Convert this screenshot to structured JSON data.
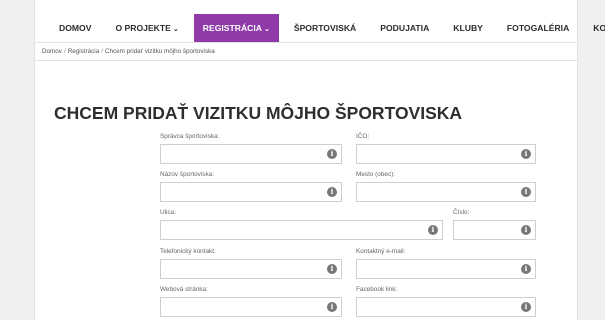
{
  "nav": {
    "items": [
      {
        "label": "DOMOV",
        "caret": ""
      },
      {
        "label": "O PROJEKTE",
        "caret": "⌄"
      },
      {
        "label": "REGISTRÁCIA",
        "caret": "⌄"
      },
      {
        "label": "ŠPORTOVISKÁ",
        "caret": ""
      },
      {
        "label": "PODUJATIA",
        "caret": ""
      },
      {
        "label": "KLUBY",
        "caret": ""
      },
      {
        "label": "FOTOGALÉRIA",
        "caret": ""
      },
      {
        "label": "KONTAKT",
        "caret": ""
      }
    ],
    "active_color": "#8e3aa8"
  },
  "breadcrumb": {
    "items": [
      "Domov",
      "Registrácia",
      "Chcem pridať vizitku môjho športoviska"
    ],
    "separator": "/"
  },
  "page": {
    "title": "CHCEM PRIDAŤ VIZITKU MÔJHO ŠPORTOVISKA"
  },
  "form": {
    "info_glyph": "i",
    "fields": [
      {
        "label": "Správca športoviska:",
        "value": ""
      },
      {
        "label": "IČO:",
        "value": ""
      },
      {
        "label": "Názov športoviska:",
        "value": ""
      },
      {
        "label": "Mesto (obec):",
        "value": ""
      },
      {
        "label": "Ulica:",
        "value": ""
      },
      {
        "label": "Číslo:",
        "value": ""
      },
      {
        "label": "Telefonický kontakt:",
        "value": ""
      },
      {
        "label": "Kontaktný e-mail:",
        "value": ""
      },
      {
        "label": "Webová stránka:",
        "value": ""
      },
      {
        "label": "Facebook link:",
        "value": ""
      }
    ]
  }
}
